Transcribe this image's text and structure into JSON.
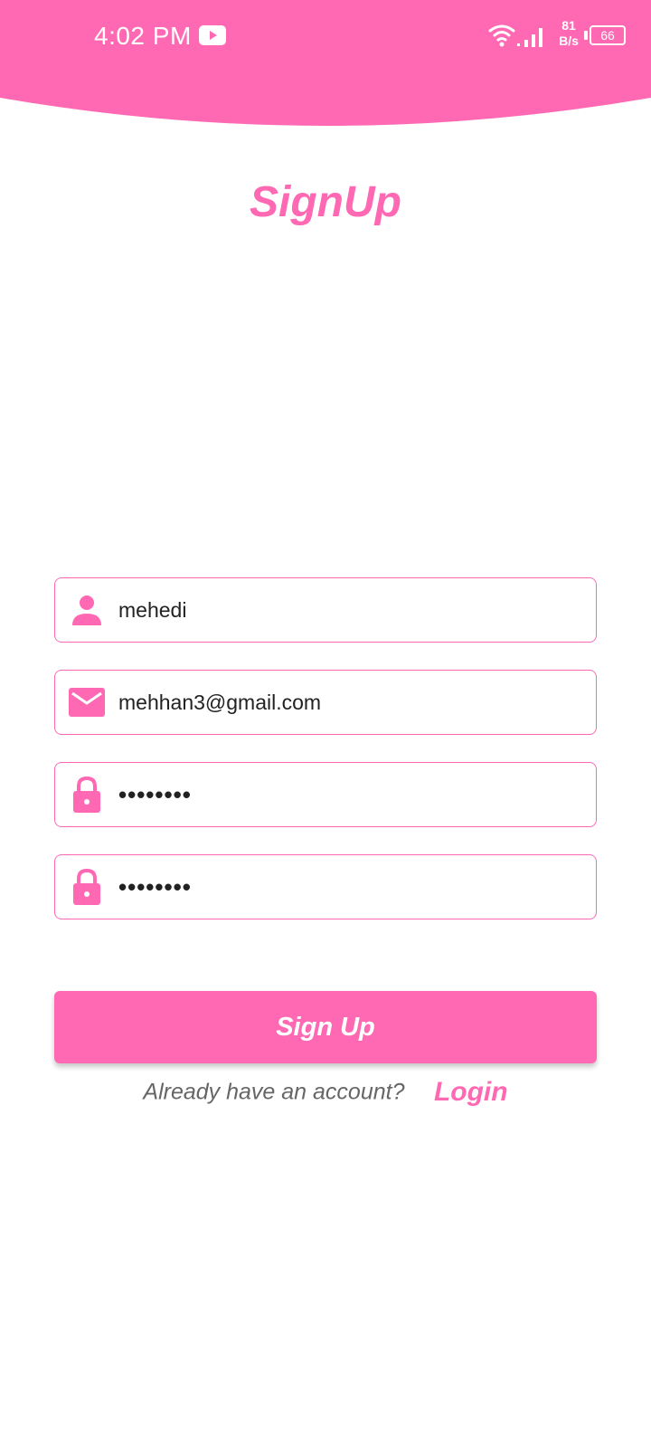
{
  "status_bar": {
    "time": "4:02 PM",
    "net_speed_value": "81",
    "net_speed_unit": "B/s",
    "battery": "66",
    "icons": [
      "youtube-icon",
      "wifi-icon",
      "cell-signal-icon",
      "battery-icon"
    ]
  },
  "page": {
    "title": "SignUp"
  },
  "form": {
    "name_value": "mehedi",
    "email_value": "mehhan3@gmail.com",
    "password_value": "••••••••",
    "confirm_password_value": "••••••••",
    "icons": [
      "person-icon",
      "mail-icon",
      "lock-icon",
      "lock-icon"
    ]
  },
  "actions": {
    "signup_label": "Sign Up",
    "login_prompt": "Already have an account?",
    "login_label": "Login"
  },
  "colors": {
    "accent": "#ff69b4",
    "background": "#ffffff",
    "input_text": "#222222",
    "prompt_text": "#666666"
  }
}
